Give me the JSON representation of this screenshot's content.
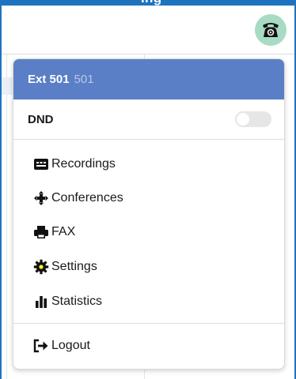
{
  "topbar": {
    "title": "ing"
  },
  "extension": {
    "label": "Ext 501",
    "number": "501"
  },
  "dnd": {
    "label": "DND",
    "enabled": false
  },
  "menu": {
    "items": [
      {
        "label": "Recordings",
        "icon": "recordings-icon"
      },
      {
        "label": "Conferences",
        "icon": "conferences-icon"
      },
      {
        "label": "FAX",
        "icon": "fax-icon"
      },
      {
        "label": "Settings",
        "icon": "gear-icon",
        "highlighted": true
      },
      {
        "label": "Statistics",
        "icon": "statistics-icon"
      }
    ],
    "logout": {
      "label": "Logout",
      "icon": "logout-icon"
    }
  },
  "colors": {
    "topbar": "#1e73be",
    "header": "#5a7fc6",
    "phone_avatar": "#a8dbc4",
    "highlight": "#fbf619"
  }
}
